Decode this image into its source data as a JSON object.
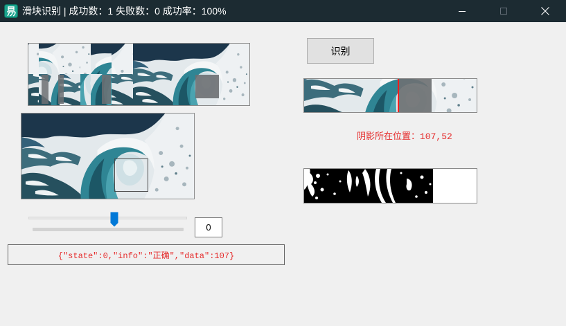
{
  "window": {
    "title": "滑块识别 | 成功数：1 失败数：0 成功率：100%",
    "icons": {
      "app": "app-icon",
      "minimize": "minimize-icon",
      "maximize": "maximize-icon",
      "close": "close-icon"
    }
  },
  "left_panel": {
    "slider": {
      "level": 0.54
    },
    "slider_value": "0",
    "result_text": "{\"state\":0,\"info\":\"正确\",\"data\":107}"
  },
  "right_panel": {
    "recognize_button": "识别",
    "shadow_position": "阴影所在位置：107,52"
  },
  "colors": {
    "title_bar": "#1c2b32",
    "window_background": "#f0f0f0",
    "accent": "#0078d7",
    "result_text": "#e52b2b",
    "marker_line": "#ff1e1e"
  }
}
